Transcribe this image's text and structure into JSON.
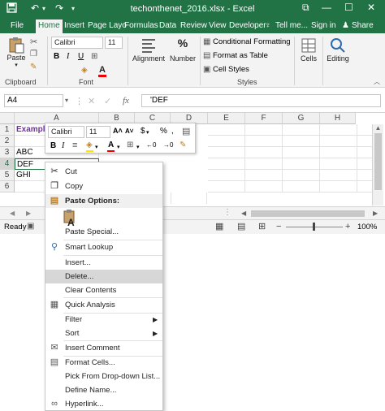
{
  "title_bar": {
    "title": "techonthenet_2016.xlsx - Excel",
    "restore_glyph": "⧉",
    "minimize_glyph": "—",
    "maximize_glyph": "☐",
    "close_glyph": "✕"
  },
  "ribbon_tabs": [
    "File",
    "Home",
    "Insert",
    "Page Layo",
    "Formulas",
    "Data",
    "Review",
    "View",
    "Developer"
  ],
  "ribbon_right": {
    "tell_me": "Tell me...",
    "sign_in": "Sign in",
    "share": "Share"
  },
  "ribbon": {
    "paste": "Paste",
    "font_name": "Calibri",
    "font_size": "11",
    "alignment": "Alignment",
    "number": "Number",
    "conditional_formatting": "Conditional Formatting",
    "format_as_table": "Format as Table",
    "cell_styles": "Cell Styles",
    "cells": "Cells",
    "editing": "Editing",
    "groups": {
      "clipboard": "Clipboard",
      "font": "Font",
      "styles": "Styles"
    }
  },
  "formula_bar": {
    "name_box": "A4",
    "fx": "fx",
    "value": "'DEF"
  },
  "grid": {
    "columns": [
      "A",
      "B",
      "C",
      "D",
      "E",
      "F",
      "G",
      "H"
    ],
    "rows": [
      "1",
      "2",
      "3",
      "4",
      "5",
      "6"
    ],
    "cells": {
      "A1": "Example",
      "A3": "ABC",
      "A4": "DEF",
      "A5": "GHI"
    }
  },
  "status": {
    "ready": "Ready",
    "zoom": "100%"
  },
  "mini_toolbar": {
    "font": "Calibri",
    "size": "11",
    "currency": "$",
    "percent": "%"
  },
  "context_menu": {
    "paste_options_header": "Paste Options:",
    "items": {
      "cut": "Cut",
      "copy": "Copy",
      "paste_special": "Paste Special...",
      "smart_lookup": "Smart Lookup",
      "insert": "Insert...",
      "delete": "Delete...",
      "clear_contents": "Clear Contents",
      "quick_analysis": "Quick Analysis",
      "filter": "Filter",
      "sort": "Sort",
      "insert_comment": "Insert Comment",
      "format_cells": "Format Cells...",
      "pick_from_dropdown": "Pick From Drop-down List...",
      "define_name": "Define Name...",
      "hyperlink": "Hyperlink..."
    }
  },
  "colors": {
    "excel_green": "#217346",
    "header_purple": "#7030a0"
  }
}
